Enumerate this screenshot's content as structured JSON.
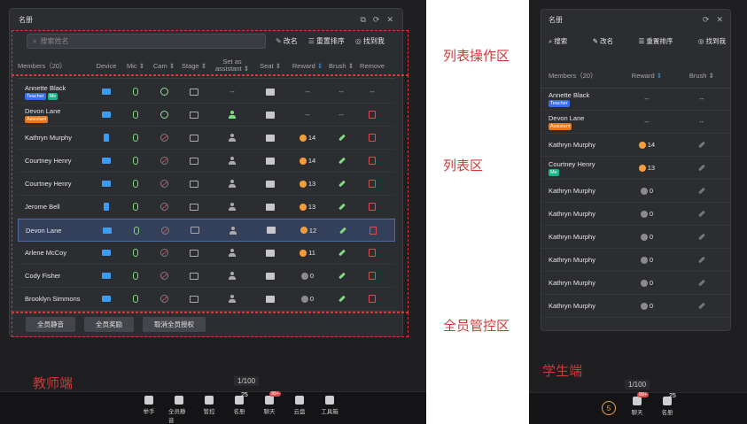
{
  "teacher": {
    "panel_title": "名册",
    "search_placeholder": "搜索姓名",
    "tools": {
      "rename": "改名",
      "sort": "重置排序",
      "find_me": "找到我"
    },
    "columns": [
      "Members（20）",
      "Device",
      "Mic",
      "Cam",
      "Stage",
      "Set as assistant",
      "Seat",
      "Reward",
      "Brush",
      "Remove"
    ],
    "rows": [
      {
        "name": "Annette Black",
        "badges": [
          "Teacher",
          "Me"
        ],
        "device": "pc",
        "cam": "on",
        "stage": "stage",
        "assistant": "--",
        "seat": "seat",
        "reward": "--",
        "brush": "--",
        "remove": "--"
      },
      {
        "name": "Devon Lane",
        "badges": [
          "Assistant"
        ],
        "device": "pc",
        "cam": "on-dim",
        "stage": "stage",
        "assistant": "green",
        "seat": "seat",
        "reward": "--",
        "brush": "--",
        "remove": "remove"
      },
      {
        "name": "Kathryn Murphy",
        "badges": [],
        "device": "phone",
        "cam": "off",
        "stage": "stage",
        "assistant": "person",
        "seat": "seat",
        "reward": "14",
        "brush": "on",
        "remove": "remove"
      },
      {
        "name": "Courtney Henry",
        "badges": [],
        "device": "pc",
        "cam": "off",
        "stage": "stage",
        "assistant": "person",
        "seat": "seat",
        "reward": "14",
        "brush": "on",
        "remove": "remove"
      },
      {
        "name": "Courtney Henry",
        "badges": [],
        "device": "pc",
        "cam": "off",
        "stage": "stage",
        "assistant": "person",
        "seat": "seat",
        "reward": "13",
        "brush": "on",
        "remove": "remove"
      },
      {
        "name": "Jerome Bell",
        "badges": [],
        "device": "phone",
        "cam": "off",
        "stage": "stage",
        "assistant": "person",
        "seat": "seat",
        "reward": "13",
        "brush": "on",
        "remove": "remove"
      },
      {
        "name": "Devon Lane",
        "badges": [],
        "device": "pc",
        "cam": "off",
        "stage": "stage",
        "assistant": "person",
        "seat": "seat",
        "reward": "12",
        "brush": "on",
        "remove": "remove",
        "highlight": true
      },
      {
        "name": "Arlene McCoy",
        "badges": [],
        "device": "pc",
        "cam": "off",
        "stage": "stage",
        "assistant": "person",
        "seat": "seat",
        "reward": "11",
        "brush": "on",
        "remove": "remove"
      },
      {
        "name": "Cody Fisher",
        "badges": [],
        "device": "pc",
        "cam": "off",
        "stage": "stage",
        "assistant": "person",
        "seat": "seat",
        "reward": "0",
        "reward_grey": true,
        "brush": "on",
        "remove": "remove"
      },
      {
        "name": "Brooklyn Simmons",
        "badges": [],
        "device": "pc",
        "cam": "off",
        "stage": "stage",
        "assistant": "person",
        "seat": "seat",
        "reward": "0",
        "reward_grey": true,
        "brush": "on",
        "remove": "remove"
      }
    ],
    "footer_buttons": [
      "全员静音",
      "全员奖励",
      "取消全员授权"
    ],
    "page_count": "1/100",
    "toolbar": [
      {
        "label": "举手",
        "icon": "hand-icon"
      },
      {
        "label": "全员静音",
        "icon": "mute-all-icon"
      },
      {
        "label": "管控",
        "icon": "control-icon"
      },
      {
        "label": "名册",
        "icon": "roster-icon",
        "count": "25"
      },
      {
        "label": "聊天",
        "icon": "chat-icon",
        "badge": "99+"
      },
      {
        "label": "云盘",
        "icon": "cloud-icon"
      },
      {
        "label": "工具箱",
        "icon": "toolbox-icon"
      }
    ]
  },
  "annotations": {
    "list_ops": "列表操作区",
    "list": "列表区",
    "all_control": "全员管控区",
    "teacher_side": "教师端",
    "student_side": "学生端"
  },
  "student": {
    "panel_title": "名册",
    "tools": {
      "search": "搜索",
      "rename": "改名",
      "sort": "重置排序",
      "find_me": "找到我"
    },
    "columns": [
      "Members（20）",
      "Reward",
      "Brush"
    ],
    "rows": [
      {
        "name": "Annette Black",
        "badges": [
          "Teacher"
        ],
        "reward": "--",
        "brush": "--"
      },
      {
        "name": "Devon Lane",
        "badges": [
          "Assistant"
        ],
        "reward": "--",
        "brush": "--"
      },
      {
        "name": "Kathryn Murphy",
        "badges": [],
        "reward": "14",
        "brush": "dim"
      },
      {
        "name": "Courtney Henry",
        "badges": [
          "Me"
        ],
        "reward": "13",
        "brush": "dim"
      },
      {
        "name": "Kathryn Murphy",
        "badges": [],
        "reward": "0",
        "reward_grey": true,
        "brush": "dim"
      },
      {
        "name": "Kathryn Murphy",
        "badges": [],
        "reward": "0",
        "reward_grey": true,
        "brush": "dim"
      },
      {
        "name": "Kathryn Murphy",
        "badges": [],
        "reward": "0",
        "reward_grey": true,
        "brush": "dim"
      },
      {
        "name": "Kathryn Murphy",
        "badges": [],
        "reward": "0",
        "reward_grey": true,
        "brush": "dim"
      },
      {
        "name": "Kathryn Murphy",
        "badges": [],
        "reward": "0",
        "reward_grey": true,
        "brush": "dim"
      },
      {
        "name": "Kathryn Murphy",
        "badges": [],
        "reward": "0",
        "reward_grey": true,
        "brush": "dim"
      }
    ],
    "page_count": "1/100",
    "circle_value": "5",
    "toolbar": [
      {
        "label": "聊天",
        "icon": "chat-icon",
        "badge": "99+"
      },
      {
        "label": "名册",
        "icon": "roster-icon",
        "count": "25"
      }
    ]
  },
  "colors": {
    "annotation_red": "#d23a3a",
    "accent_blue": "#3a9cf4",
    "green": "#7bdc7b",
    "orange": "#f29f3b"
  }
}
